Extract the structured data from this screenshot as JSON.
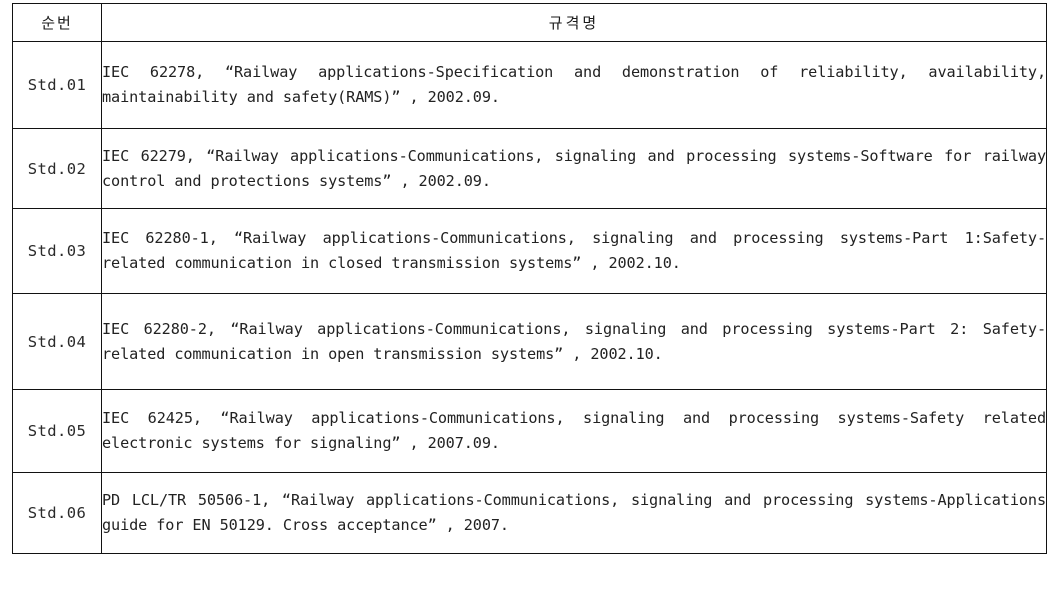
{
  "table": {
    "headers": {
      "number": "순번",
      "name": "규격명"
    },
    "rows": [
      {
        "number": "Std.01",
        "name": "IEC 62278, “Railway applications-Specification and demonstration of reliability, availability, maintainability and safety(RAMS)” , 2002.09."
      },
      {
        "number": "Std.02",
        "name": "IEC 62279, “Railway applications-Communications, signaling and processing systems-Software for railway control and protections systems” , 2002.09."
      },
      {
        "number": "Std.03",
        "name": "IEC 62280-1, “Railway applications-Communications, signaling and processing systems-Part 1:Safety-related communication in closed transmission systems” , 2002.10."
      },
      {
        "number": "Std.04",
        "name": "IEC 62280-2, “Railway applications-Communications, signaling and processing systems-Part 2: Safety-related communication in open transmission systems” , 2002.10."
      },
      {
        "number": "Std.05",
        "name": "IEC 62425, “Railway applications-Communications, signaling and processing systems-Safety related electronic systems for signaling” , 2007.09."
      },
      {
        "number": "Std.06",
        "name": "PD LCL/TR 50506-1, “Railway applications-Communications, signaling and processing systems-Applications guide for EN 50129. Cross acceptance” , 2007."
      }
    ]
  },
  "colors": {
    "border": "#121212",
    "text": "#222222",
    "background": "#ffffff"
  }
}
